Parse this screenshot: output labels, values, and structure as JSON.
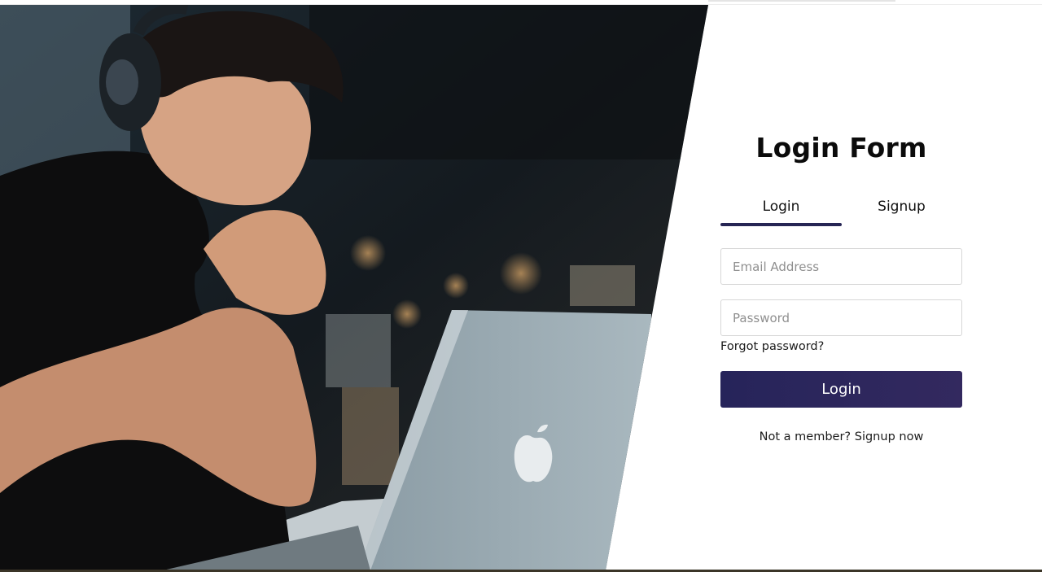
{
  "page": {
    "colors": {
      "accent": "#262554",
      "button_bg": "#2b275c",
      "text": "#111111",
      "placeholder": "#8f8f8f"
    }
  },
  "hero": {
    "image_subject": "man-with-headphones-at-laptop"
  },
  "form": {
    "title": "Login Form",
    "tabs": [
      {
        "label": "Login",
        "active": true
      },
      {
        "label": "Signup",
        "active": false
      }
    ],
    "email": {
      "placeholder": "Email Address",
      "value": ""
    },
    "password": {
      "placeholder": "Password",
      "value": ""
    },
    "forgot_label": "Forgot password?",
    "submit_label": "Login",
    "member_text": "Not a member?",
    "signup_link_label": "Signup now"
  }
}
